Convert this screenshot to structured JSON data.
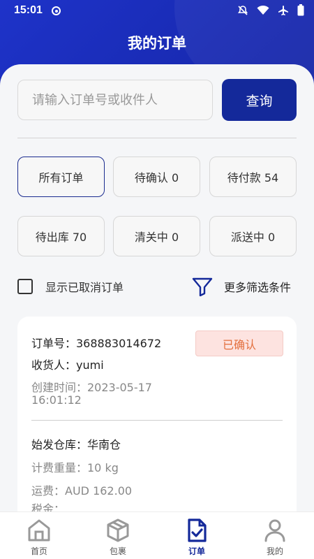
{
  "status": {
    "time": "15:01"
  },
  "header": {
    "title": "我的订单"
  },
  "search": {
    "placeholder": "请输入订单号或收件人",
    "button_label": "查询"
  },
  "filters": [
    {
      "label": "所有订单",
      "active": true
    },
    {
      "label": "待确认 0",
      "active": false
    },
    {
      "label": "待付款 54",
      "active": false
    },
    {
      "label": "待出库 70",
      "active": false
    },
    {
      "label": "清关中 0",
      "active": false
    },
    {
      "label": "派送中 0",
      "active": false
    }
  ],
  "show_cancelled": {
    "label": "显示已取消订单",
    "checked": false
  },
  "more_filters": {
    "label": "更多筛选条件"
  },
  "order": {
    "number": "订单号：368883014672",
    "status": "已确认",
    "receiver": "收货人：yumi",
    "created_line1": "创建时间：2023-05-17",
    "created_line2": "16:01:12",
    "warehouse": "始发仓库：华南仓",
    "weight": "计费重量：10 kg",
    "fee": "运费：AUD 162.00",
    "tax": "税金："
  },
  "tabs": [
    {
      "label": "首页",
      "icon": "home-icon",
      "active": false
    },
    {
      "label": "包裹",
      "icon": "package-icon",
      "active": false
    },
    {
      "label": "订单",
      "icon": "order-icon",
      "active": true
    },
    {
      "label": "我的",
      "icon": "user-icon",
      "active": false
    }
  ],
  "colors": {
    "primary": "#14299a",
    "header": "#1a2bb5",
    "badge_bg": "#fde3e0",
    "badge_text": "#e36f3d"
  }
}
